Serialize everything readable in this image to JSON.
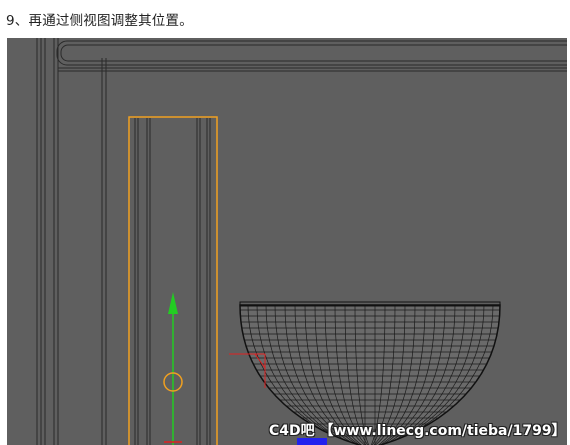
{
  "caption": "9、再通过侧视图调整其位置。",
  "viewport": {
    "background_color": "#5f5f5f",
    "selection_color": "#f0a020",
    "axis_colors": {
      "y": "#22cc22",
      "x": "#e02020",
      "z": "#2222ee"
    }
  },
  "watermark": "C4D吧 【www.linecg.com/tieba/1799】"
}
